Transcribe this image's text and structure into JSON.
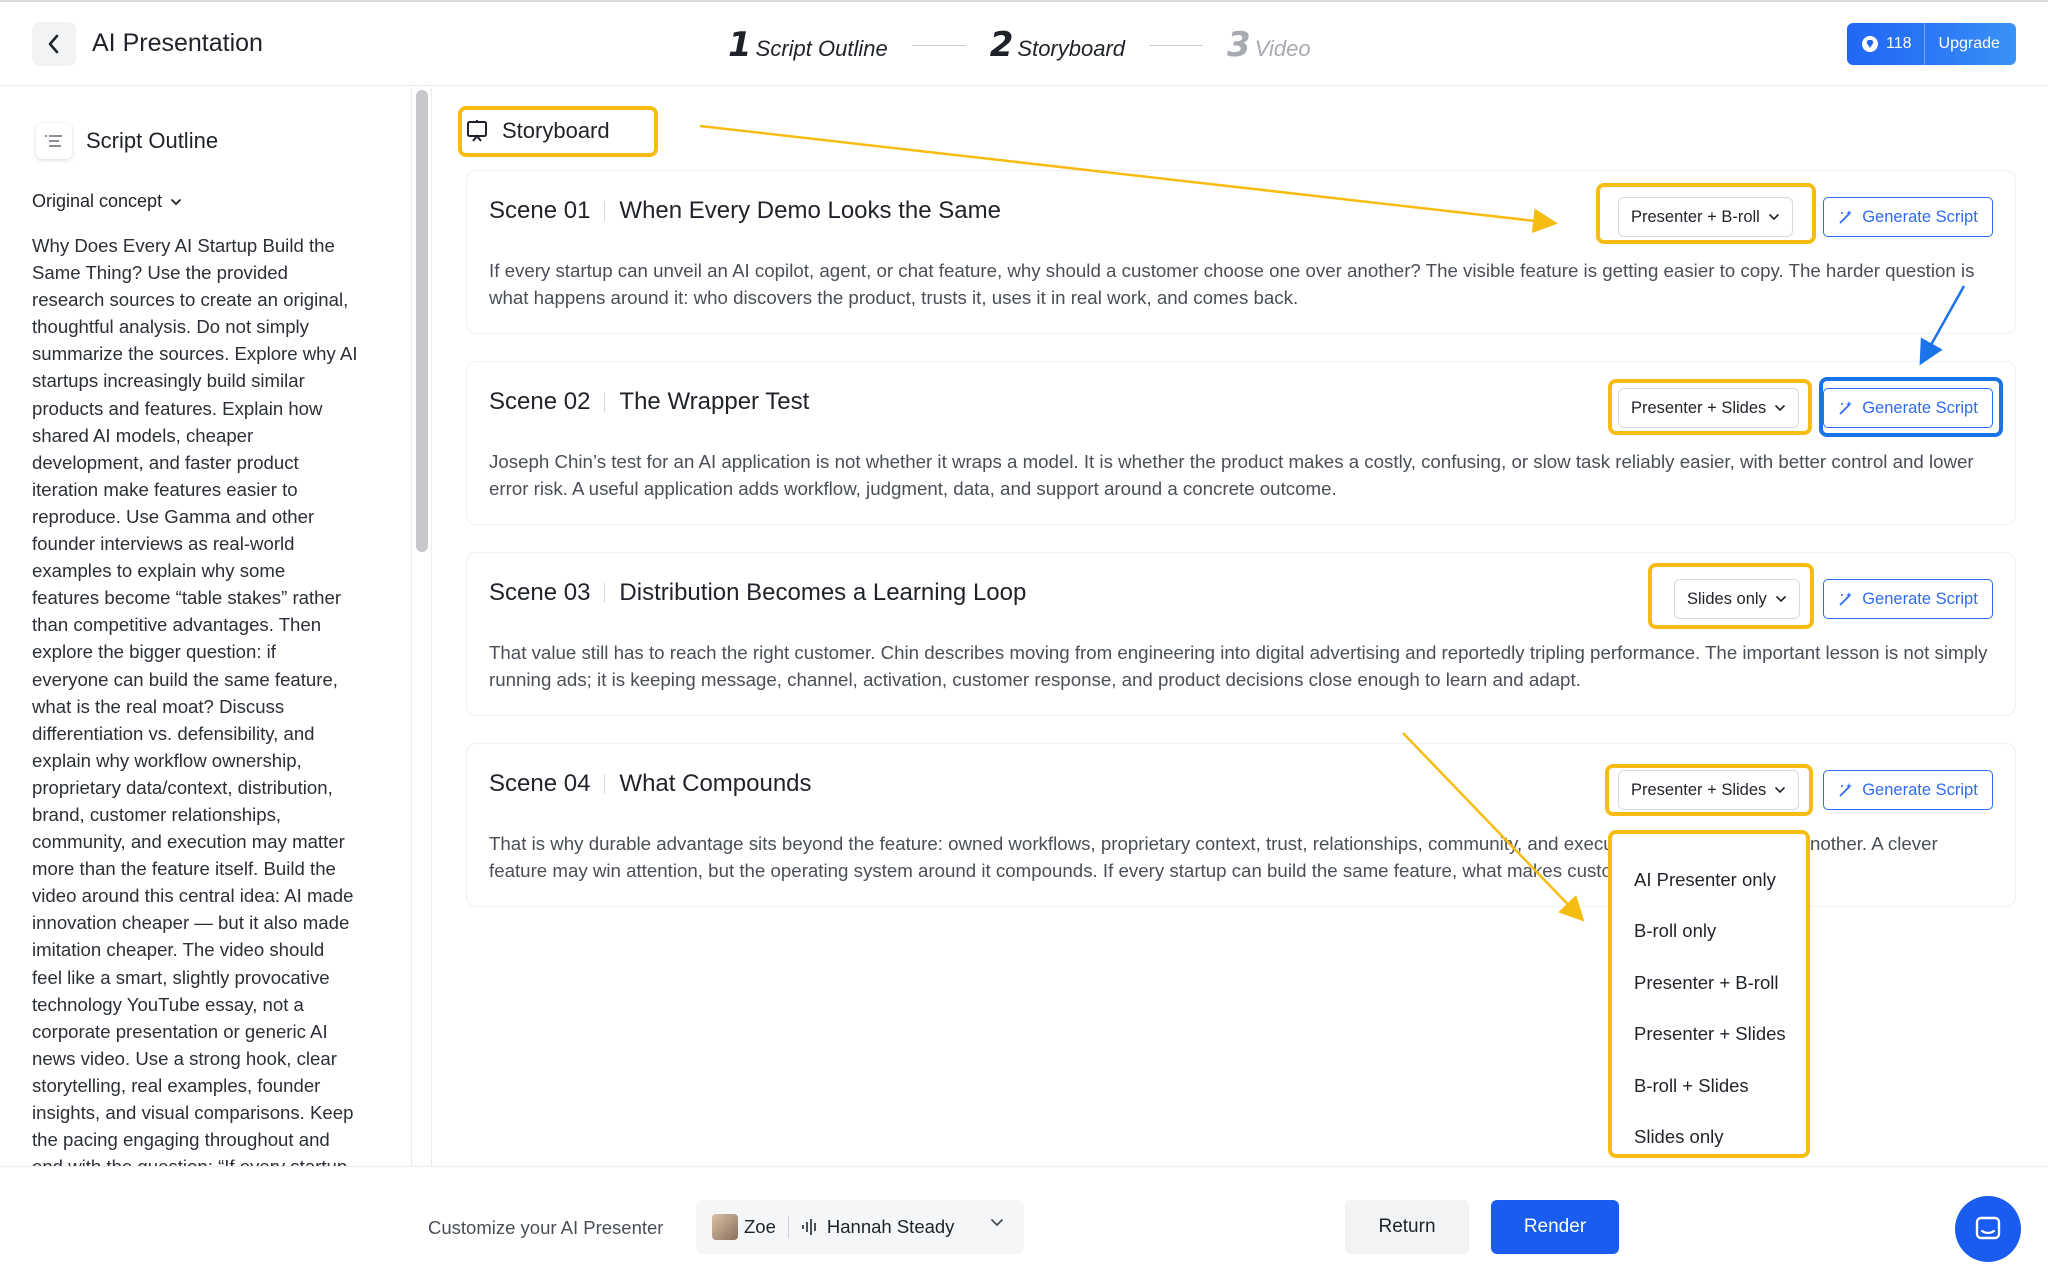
{
  "header": {
    "title": "AI Presentation",
    "steps": [
      {
        "num": "1",
        "label": "Script Outline"
      },
      {
        "num": "2",
        "label": "Storyboard"
      },
      {
        "num": "3",
        "label": "Video"
      }
    ],
    "credits": "118",
    "upgrade_label": "Upgrade",
    "brand_color": "#2166f3"
  },
  "sidebar": {
    "title": "Script Outline",
    "concept_label": "Original concept",
    "concept_lines": [
      "Why Does Every AI Startup Build the",
      "Same Thing? Use the provided",
      "research sources to create an original,",
      "thoughtful analysis. Do not simply",
      "summarize the sources. Explore why AI",
      "startups increasingly build similar",
      "products and features. Explain how",
      "shared AI models, cheaper",
      "development, and faster product",
      "iteration make features easier to",
      "reproduce. Use Gamma and other",
      "founder interviews as real-world",
      "examples to explain why some",
      "features become “table stakes” rather",
      "than competitive advantages. Then",
      "explore the bigger question: if",
      "everyone can build the same feature,",
      "what is the real moat? Discuss",
      "differentiation vs. defensibility, and",
      "explain why workflow ownership,",
      "proprietary data/context, distribution,",
      "brand, customer relationships,",
      "community, and execution may matter",
      "more than the feature itself. Build the",
      "video around this central idea: AI made",
      "innovation cheaper — but it also made",
      "imitation cheaper. The video should",
      "feel like a smart, slightly provocative",
      "technology YouTube essay, not a",
      "corporate presentation or generic AI",
      "news video. Use a strong hook, clear",
      "storytelling, real examples, founder",
      "insights, and visual comparisons. Keep",
      "the pacing engaging throughout and",
      "end with the question: “If every startup"
    ]
  },
  "main": {
    "section_label": "Storyboard",
    "generate_label": "Generate Script",
    "scenes": [
      {
        "number": "Scene 01",
        "title": "When Every Demo Looks the Same",
        "mode": "Presenter + B-roll",
        "description": "If every startup can unveil an AI copilot, agent, or chat feature, why should a customer choose one over another? The visible feature is getting easier to copy. The harder question is what happens around it: who discovers the product, trusts it, uses it in real work, and comes back."
      },
      {
        "number": "Scene 02",
        "title": "The Wrapper Test",
        "mode": "Presenter + Slides",
        "description": "Joseph Chin’s test for an AI application is not whether it wraps a model. It is whether the product makes a costly, confusing, or slow task reliably easier, with better control and lower error risk. A useful application adds workflow, judgment, data, and support around a concrete outcome."
      },
      {
        "number": "Scene 03",
        "title": "Distribution Becomes a Learning Loop",
        "mode": "Slides only",
        "description": "That value still has to reach the right customer. Chin describes moving from engineering into digital advertising and reportedly tripling performance. The important lesson is not simply running ads; it is keeping message, channel, activation, customer response, and product decisions close enough to learn and adapt."
      },
      {
        "number": "Scene 04",
        "title": "What Compounds",
        "mode": "Presenter + Slides",
        "description": "That is why durable advantage sits beyond the feature: owned workflows, proprietary context, trust, relationships, community, and execution that reinforce one another. A clever feature may win attention, but the operating system around it compounds. If every startup can build the same feature, what makes customers keep choosing?"
      }
    ],
    "mode_options": [
      "AI Presenter only",
      "B-roll only",
      "Presenter + B-roll",
      "Presenter + Slides",
      "B-roll + Slides",
      "Slides only"
    ]
  },
  "footer": {
    "customize_label": "Customize your AI Presenter",
    "presenter_name": "Zoe",
    "voice_name": "Hannah Steady",
    "return_label": "Return",
    "render_label": "Render"
  },
  "colors": {
    "highlight": "#f7bc12",
    "highlight_blue": "#1a73e8",
    "primary": "#1a5cf0"
  }
}
